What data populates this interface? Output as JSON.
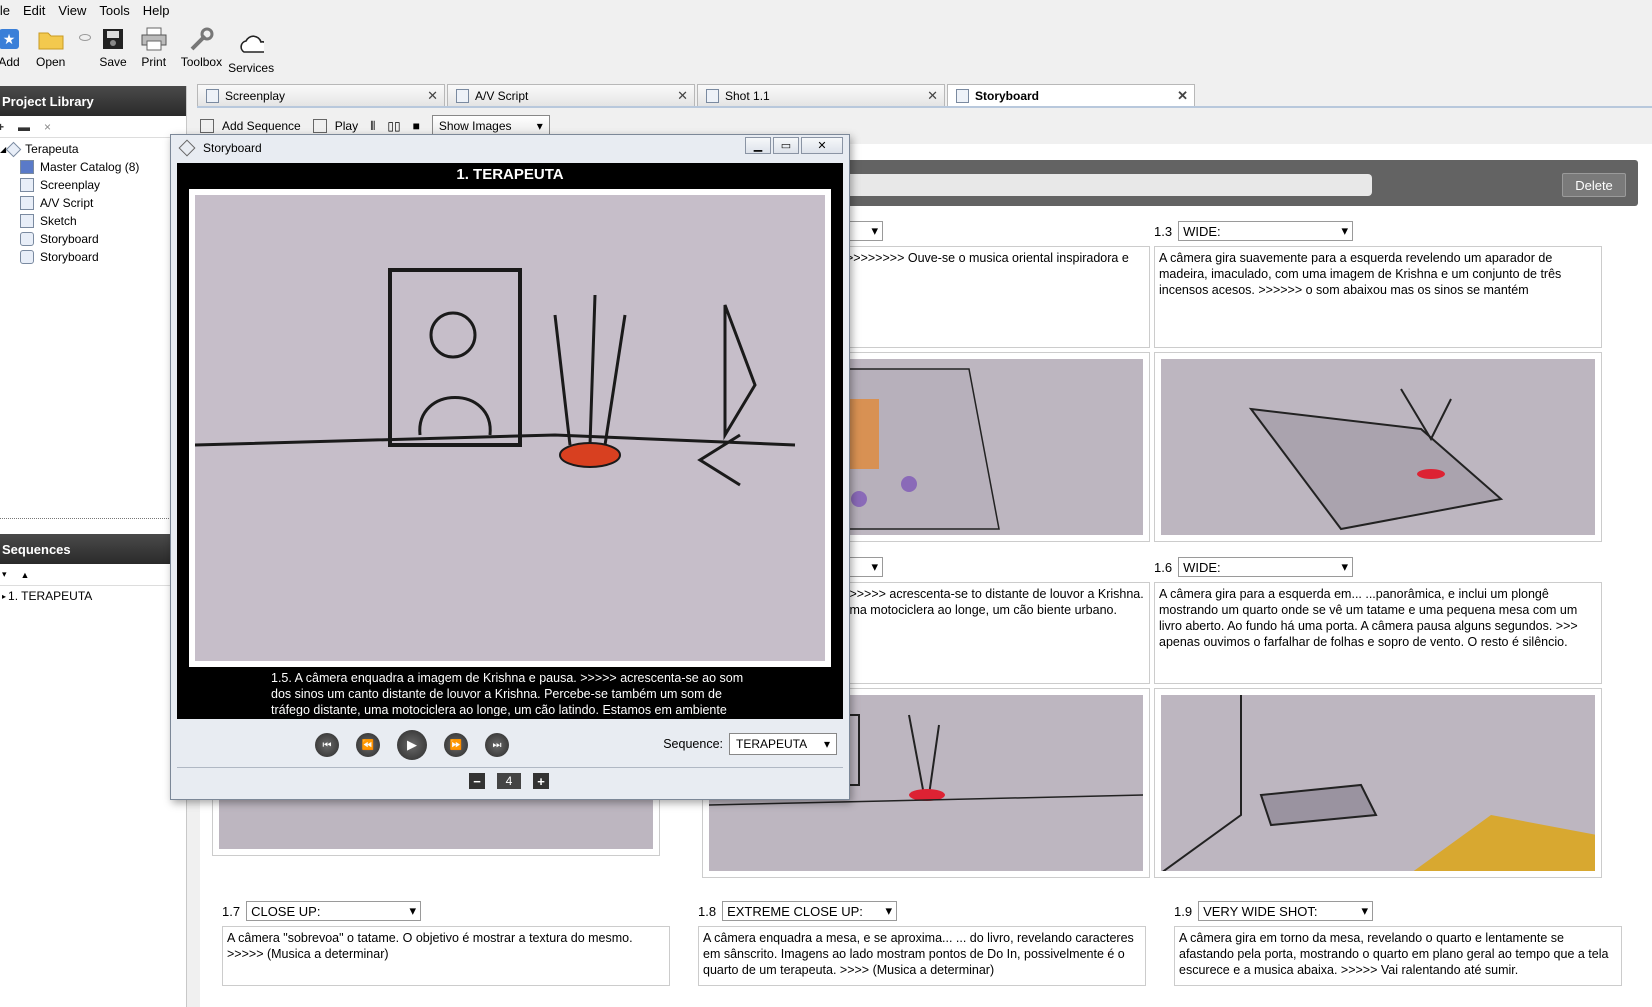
{
  "menu": [
    "ile",
    "Edit",
    "View",
    "Tools",
    "Help"
  ],
  "toolbar": {
    "add": "Add",
    "open": "Open",
    "save": "Save",
    "print": "Print",
    "toolbox": "Toolbox",
    "services": "Services"
  },
  "library": {
    "title": "Project Library",
    "items": [
      "Terapeuta",
      "Master Catalog (8)",
      "Screenplay",
      "A/V Script",
      "Sketch",
      "Storyboard",
      "Storyboard"
    ]
  },
  "sequences": {
    "title": "Sequences",
    "items": [
      "1. TERAPEUTA"
    ]
  },
  "tabs": [
    {
      "label": "Screenplay"
    },
    {
      "label": "A/V Script"
    },
    {
      "label": "Shot 1.1"
    },
    {
      "label": "Storyboard"
    }
  ],
  "subtoolbar": {
    "add_sequence": "Add Sequence",
    "play": "Play",
    "show_images": "Show Images"
  },
  "board": {
    "delete": "Delete",
    "shots": [
      {
        "num": "",
        "type": "",
        "text": "um sino de bambú. >>>>>>>>>>>> Ouve-se o musica oriental inspiradora e calma, ao fundo."
      },
      {
        "num": "1.3",
        "type": "WIDE:",
        "text": "A câmera gira suavemente para a esquerda revelendo um aparador de madeira, imaculado, com uma imagem de Krishna e um conjunto de três incensos acesos. >>>>>>  o som abaixou mas os sinos se mantém"
      },
      {
        "num": "",
        "type": "",
        "text": "gem de Krishna e pausa. >>>>> acrescenta-se to distante de louvor a Krishna. Percebe-se go distante, uma motociclera ao longe, um cão biente urbano."
      },
      {
        "num": "1.6",
        "type": "WIDE:",
        "text": "A câmera gira para a esquerda em... ...panorâmica, e inclui um plongê mostrando um quarto onde se vê um tatame e uma pequena mesa com um livro aberto. Ao fundo há uma porta. A câmera pausa alguns segundos. >>> apenas ouvimos o farfalhar de folhas e sopro de vento. O resto é silêncio."
      },
      {
        "num": "1.7",
        "type": "CLOSE UP:",
        "text": "A câmera \"sobrevoa\" o tatame. O objetivo é mostrar a textura do mesmo. >>>>>  (Musica a determinar)"
      },
      {
        "num": "1.8",
        "type": "EXTREME CLOSE UP:",
        "text": "A câmera enquadra a mesa, e se aproxima... ... do livro, revelando caracteres em sânscrito. Imagens ao lado mostram pontos de Do In, possivelmente é o quarto de um terapeuta. >>>> (Musica a determinar)"
      },
      {
        "num": "1.9",
        "type": "VERY WIDE SHOT:",
        "text": "A câmera gira em torno da mesa, revelando o quarto e lentamente se afastando pela porta, mostrando o quarto em plano geral ao tempo que a tela escurece e a musica abaixa. >>>>> Vai ralentando até sumir."
      }
    ]
  },
  "player": {
    "window_title": "Storyboard",
    "heading": "1. TERAPEUTA",
    "caption": "1.5. A câmera enquadra a imagem de Krishna e pausa. >>>>> acrescenta-se ao som dos sinos um canto distante de louvor a Krishna. Percebe-se também um som de tráfego distante, uma motociclera ao longe, um cão latindo. Estamos em ambiente urbano.",
    "sequence_label": "Sequence:",
    "sequence_value": "TERAPEUTA",
    "page": "4"
  }
}
